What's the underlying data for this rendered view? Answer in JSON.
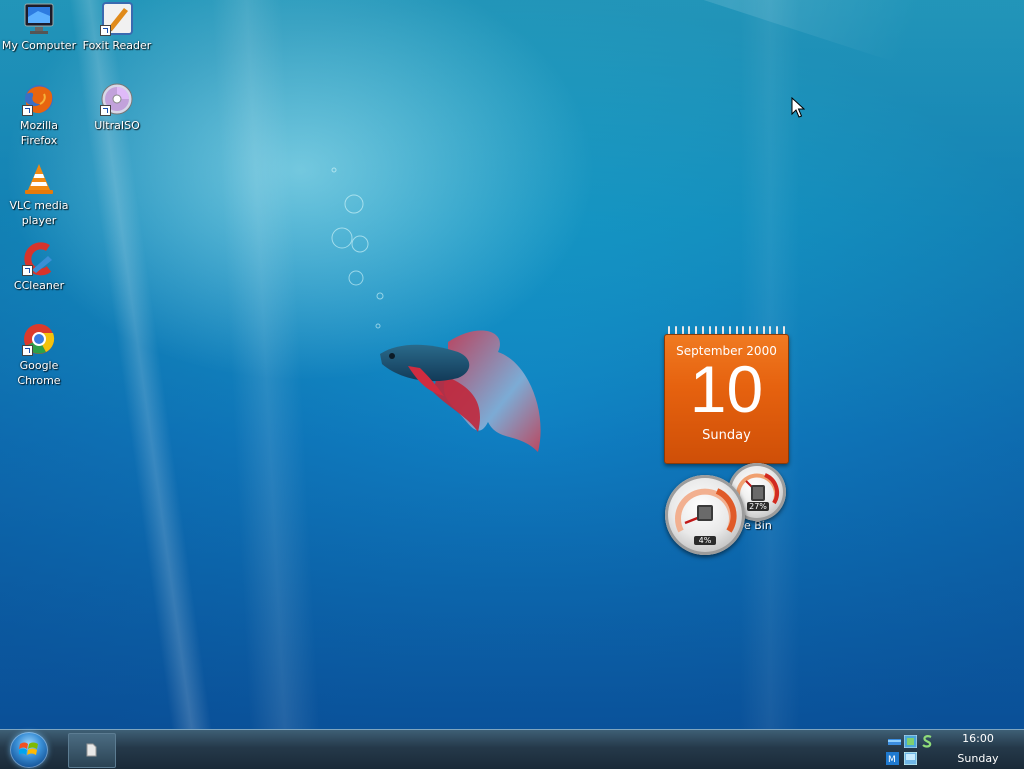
{
  "desktop": {
    "icons": [
      {
        "label": "My Computer",
        "icon": "computer-monitor-icon"
      },
      {
        "label": "Foxit Reader",
        "icon": "foxit-reader-icon"
      },
      {
        "label": "Mozilla Firefox",
        "icon": "firefox-icon"
      },
      {
        "label": "UltraISO",
        "icon": "ultraiso-disc-icon"
      },
      {
        "label": "VLC media player",
        "icon": "vlc-cone-icon"
      },
      {
        "label": "CCleaner",
        "icon": "ccleaner-icon"
      },
      {
        "label": "Google Chrome",
        "icon": "chrome-icon"
      }
    ],
    "recycle_bin_label": "e Bin"
  },
  "calendar_gadget": {
    "month_year": "September 2000",
    "day": "10",
    "weekday": "Sunday",
    "color": "#e6620f"
  },
  "cpu_meter_gadget": {
    "cpu_percent": "4%",
    "memory_percent": "27%",
    "cpu_value": 0.04,
    "memory_value": 0.27
  },
  "taskbar": {
    "start_icon": "windows-start-orb-icon",
    "running_app_icon": "document-icon",
    "tray_icons": [
      "network-icon",
      "monitor-icon",
      "s-app-icon",
      "keyboard-icon",
      "display-icon"
    ],
    "clock_time": "16:00",
    "clock_day": "Sunday"
  },
  "colors": {
    "wallpaper_top": "#2fc5d6",
    "wallpaper_bottom": "#0a5aa3",
    "taskbar": "#25394a"
  }
}
